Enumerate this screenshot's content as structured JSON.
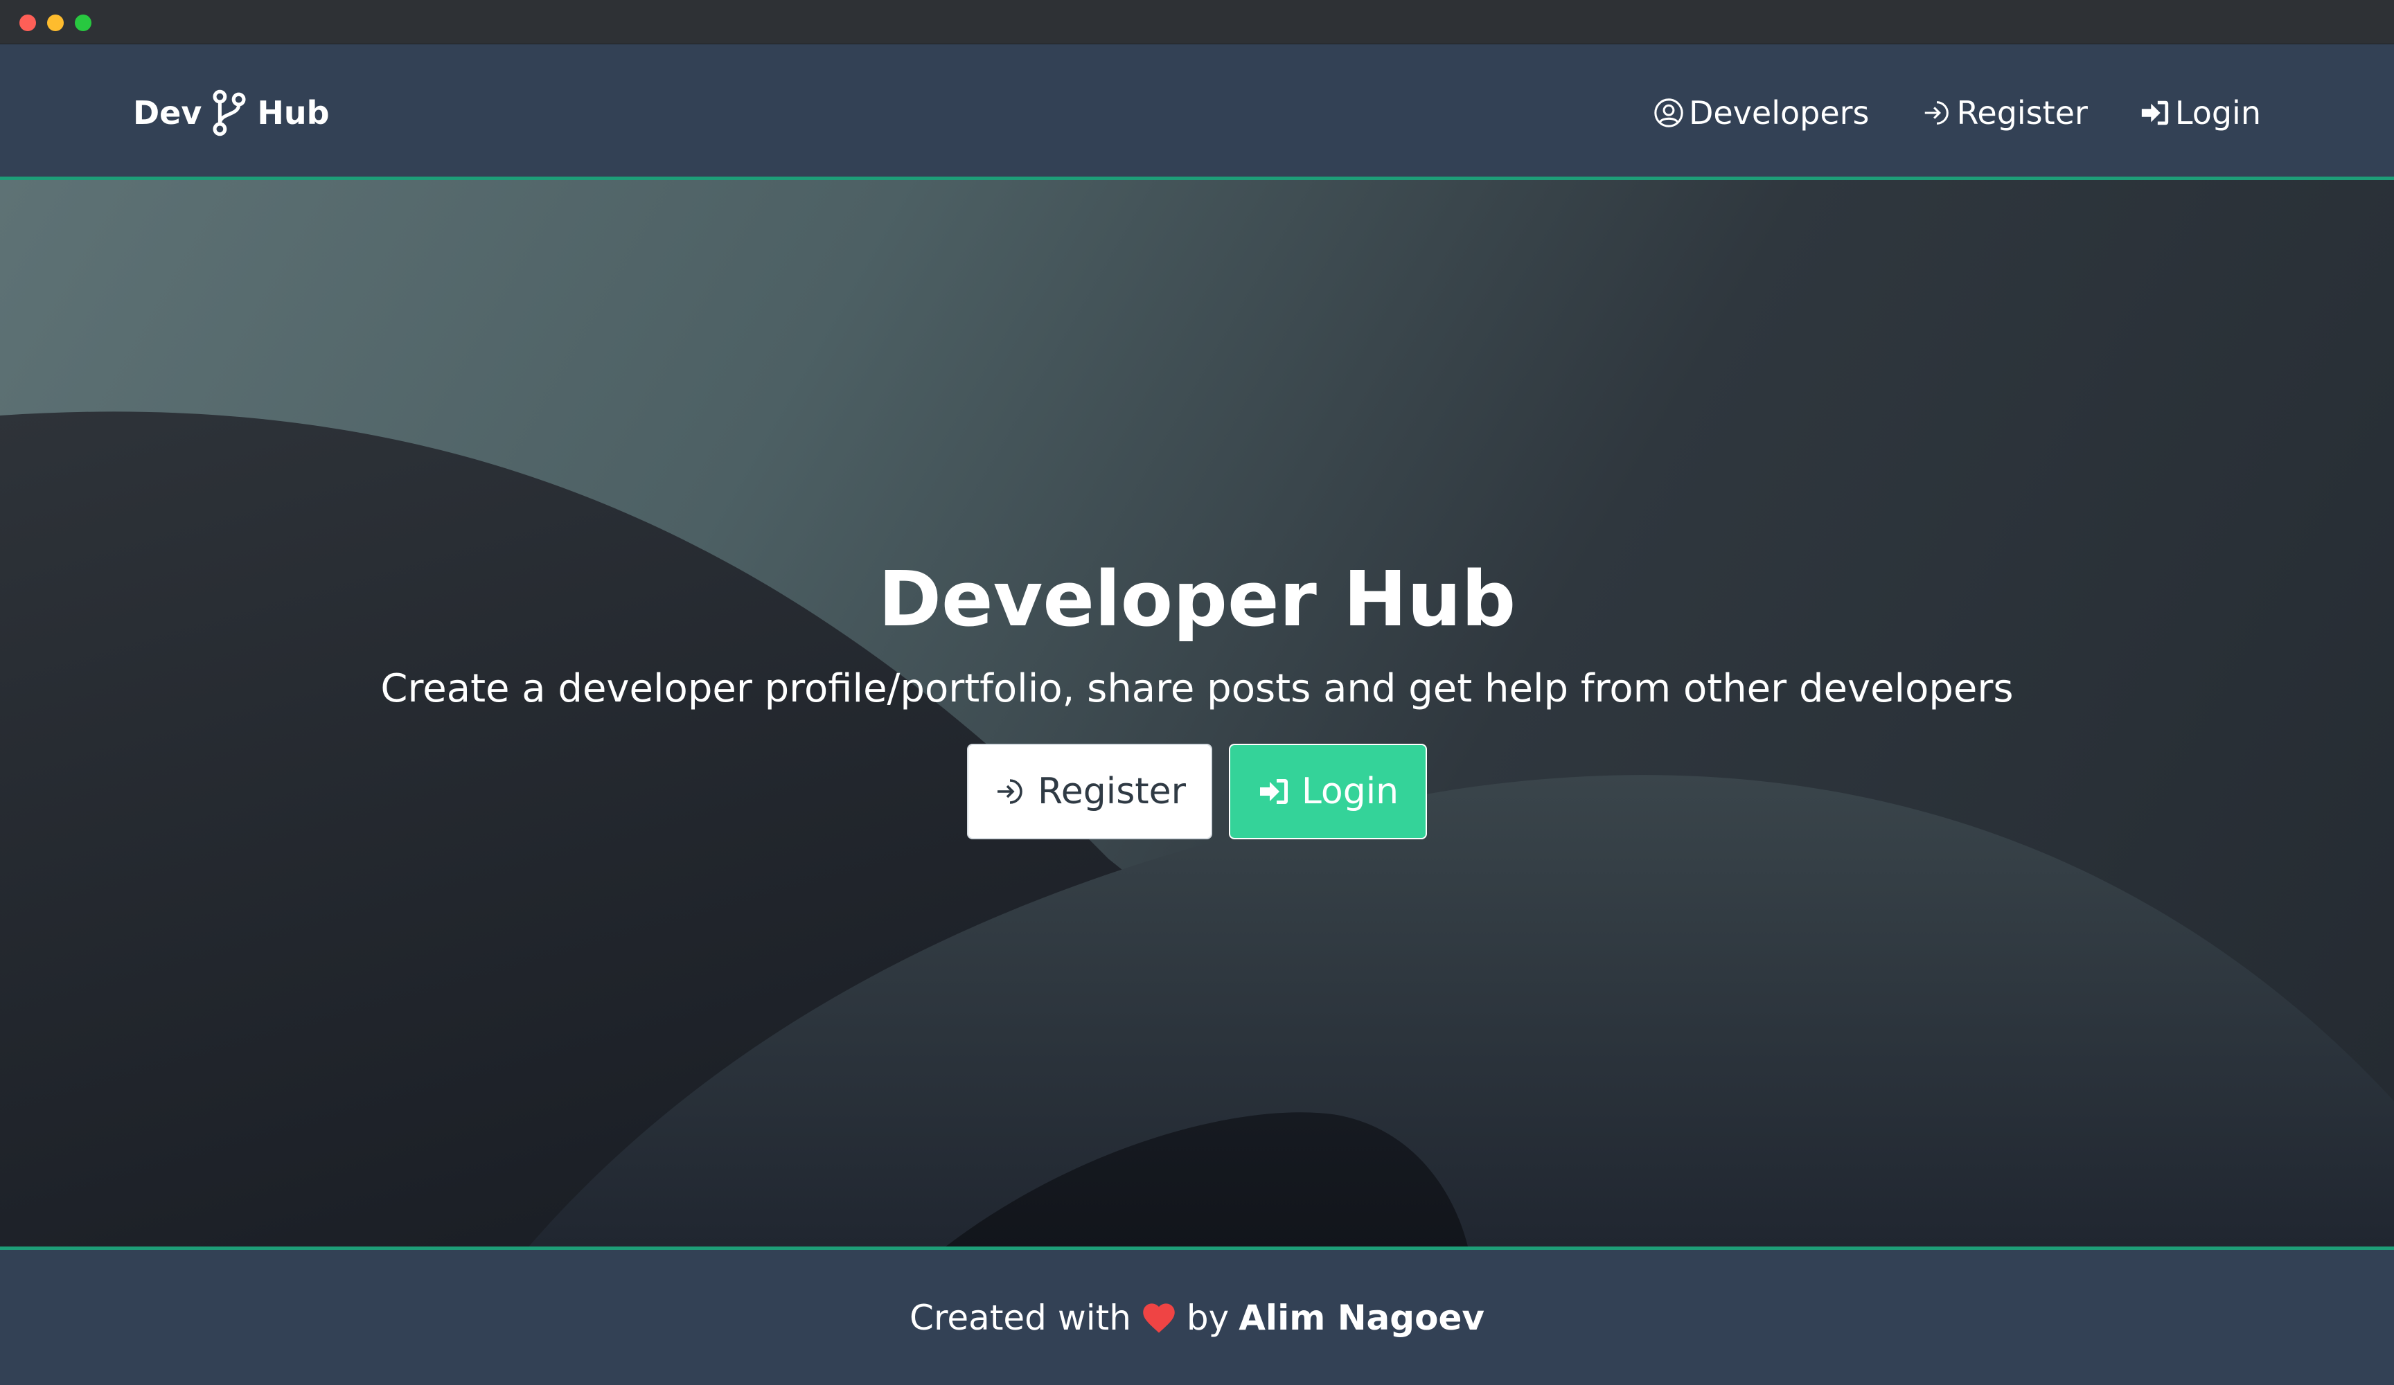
{
  "window": {
    "controls": [
      "close",
      "minimize",
      "maximize"
    ]
  },
  "navbar": {
    "brand": {
      "text_left": "Dev",
      "icon": "git-branch-icon",
      "text_right": "Hub"
    },
    "links": [
      {
        "label": "Developers",
        "icon": "user-circle-icon"
      },
      {
        "label": "Register",
        "icon": "sign-in-outline-icon"
      },
      {
        "label": "Login",
        "icon": "sign-in-solid-icon"
      }
    ],
    "accent_border_color": "#1e9e78",
    "background_color": "#334155"
  },
  "hero": {
    "title": "Developer Hub",
    "subtitle": "Create a developer profile/portfolio, share posts and get help from other developers",
    "buttons": {
      "register": {
        "label": "Register",
        "icon": "sign-in-outline-icon"
      },
      "login": {
        "label": "Login",
        "icon": "sign-in-solid-icon",
        "color": "#34d399"
      }
    }
  },
  "footer": {
    "prefix": "Created with",
    "icon": "heart-icon",
    "middle": "by",
    "author": "Alim Nagoev",
    "heart_color": "#ef4444"
  }
}
